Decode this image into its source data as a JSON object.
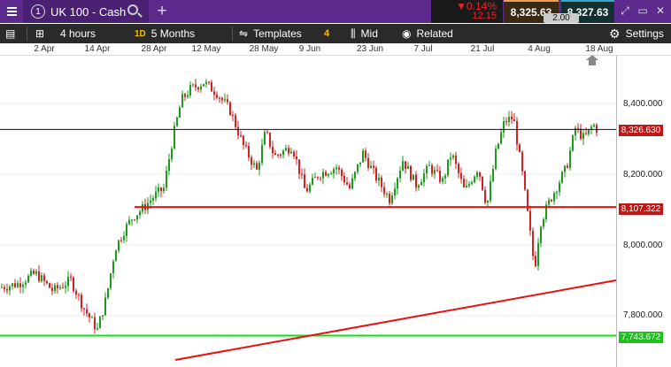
{
  "instrument": {
    "number": "1",
    "name": "UK 100 - Cash"
  },
  "quote": {
    "change_pct": "▼0.14%",
    "change_pts": "12.15",
    "sell": "8,325.63",
    "buy": "8,327.63",
    "spread": "2.00"
  },
  "toolbar": {
    "interval": "4 hours",
    "period_badge": "1D",
    "range": "5 Months",
    "templates": "Templates",
    "template_count": "4",
    "price_type": "Mid",
    "related": "Related",
    "settings": "Settings"
  },
  "x_axis": [
    "2 Apr",
    "14 Apr",
    "28 Apr",
    "12 May",
    "28 May",
    "9 Jun",
    "23 Jun",
    "7 Jul",
    "21 Jul",
    "4 Aug",
    "18 Aug"
  ],
  "y_axis": [
    "8,400.000",
    "8,200.000",
    "8,000.000",
    "7,800.000"
  ],
  "price_tags": {
    "current": "8,326.630",
    "support": "8,107.322",
    "low": "7,743.672"
  },
  "colors": {
    "up": "#1e9a1e",
    "down": "#d42020",
    "support_line": "#e81010",
    "low_line": "#10e010",
    "accent": "#5b2a8c"
  },
  "chart_data": {
    "type": "candlestick",
    "x_tick_labels": [
      "2 Apr",
      "14 Apr",
      "28 Apr",
      "12 May",
      "28 May",
      "9 Jun",
      "23 Jun",
      "7 Jul",
      "21 Jul",
      "4 Aug",
      "18 Aug"
    ],
    "y_tick_values": [
      7800,
      8000,
      8200,
      8400
    ],
    "ylim": [
      7700,
      8480
    ],
    "close_path": [
      [
        0,
        7880
      ],
      [
        20,
        7890
      ],
      [
        40,
        7920
      ],
      [
        60,
        7870
      ],
      [
        80,
        7900
      ],
      [
        95,
        7820
      ],
      [
        110,
        7760
      ],
      [
        120,
        7850
      ],
      [
        130,
        7990
      ],
      [
        140,
        8040
      ],
      [
        150,
        8080
      ],
      [
        160,
        8100
      ],
      [
        175,
        8140
      ],
      [
        185,
        8160
      ],
      [
        195,
        8300
      ],
      [
        205,
        8410
      ],
      [
        215,
        8440
      ],
      [
        230,
        8460
      ],
      [
        245,
        8430
      ],
      [
        260,
        8380
      ],
      [
        275,
        8280
      ],
      [
        290,
        8210
      ],
      [
        300,
        8320
      ],
      [
        310,
        8250
      ],
      [
        330,
        8280
      ],
      [
        345,
        8150
      ],
      [
        360,
        8200
      ],
      [
        380,
        8220
      ],
      [
        395,
        8160
      ],
      [
        410,
        8260
      ],
      [
        425,
        8190
      ],
      [
        440,
        8130
      ],
      [
        455,
        8240
      ],
      [
        470,
        8170
      ],
      [
        485,
        8220
      ],
      [
        500,
        8180
      ],
      [
        510,
        8260
      ],
      [
        525,
        8150
      ],
      [
        540,
        8220
      ],
      [
        550,
        8110
      ],
      [
        560,
        8260
      ],
      [
        570,
        8350
      ],
      [
        580,
        8360
      ],
      [
        590,
        8200
      ],
      [
        598,
        8050
      ],
      [
        604,
        7930
      ],
      [
        610,
        8060
      ],
      [
        620,
        8120
      ],
      [
        640,
        8220
      ],
      [
        650,
        8330
      ],
      [
        660,
        8300
      ],
      [
        670,
        8340
      ],
      [
        675,
        8326
      ]
    ],
    "current_price": 8326.63,
    "support_level": 8107.322,
    "low_level": 7743.672
  }
}
